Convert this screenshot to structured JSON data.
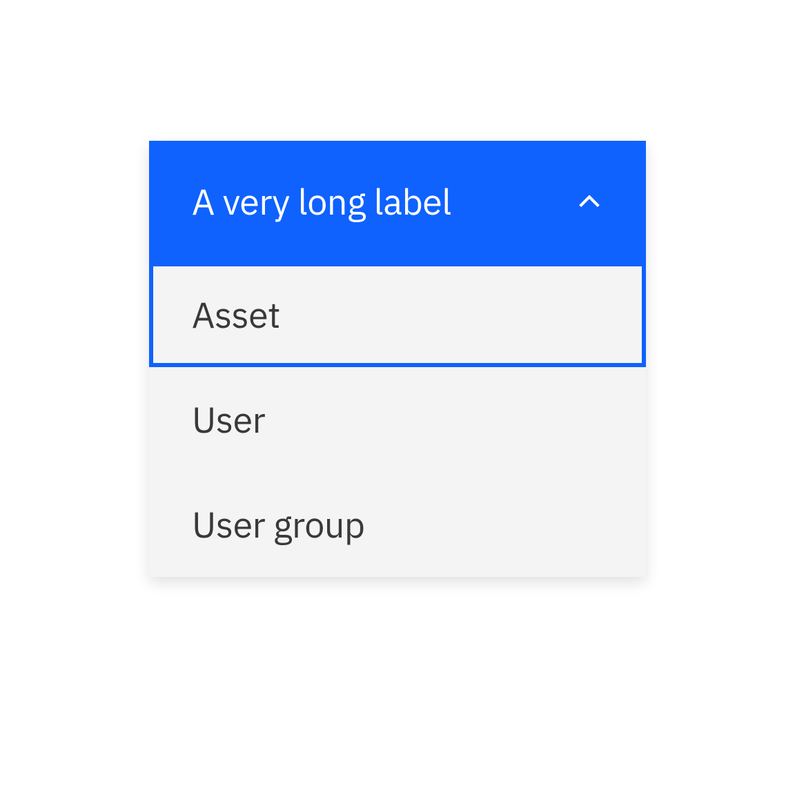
{
  "dropdown": {
    "label": "A very long label",
    "items": [
      {
        "label": "Asset"
      },
      {
        "label": "User"
      },
      {
        "label": "User group"
      }
    ]
  }
}
